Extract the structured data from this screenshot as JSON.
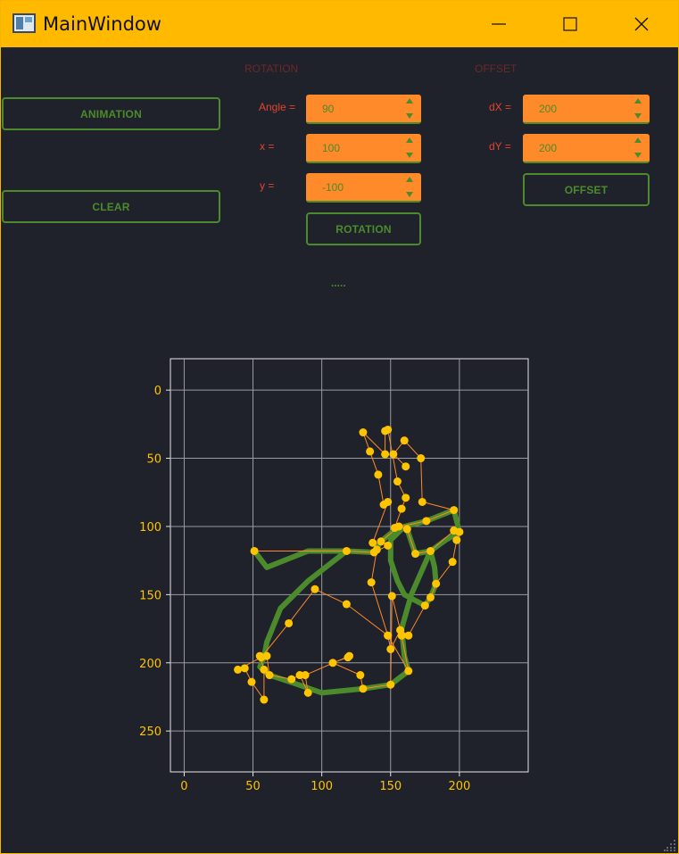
{
  "window": {
    "title": "MainWindow"
  },
  "left_panel": {
    "animation_label": "ANIMATION",
    "clear_label": "CLEAR"
  },
  "rotation": {
    "section_title": "ROTATION",
    "angle_label": "Angle =",
    "angle_value": "90",
    "x_label": "x =",
    "x_value": "100",
    "y_label": "y =",
    "y_value": "-100",
    "button_label": "ROTATION"
  },
  "offset": {
    "section_title": "OFFSET",
    "dx_label": "dX =",
    "dx_value": "200",
    "dy_label": "dY =",
    "dy_value": "200",
    "button_label": "OFFSET"
  },
  "status_text": ".....",
  "colors": {
    "titlebar": "#ffba00",
    "background": "#1f212b",
    "accent_green": "#4c8b2b",
    "label_red": "#e0452f",
    "spin_orange": "#ff8a2a",
    "point_yellow": "#ffc400",
    "control_line": "#ff8a2a",
    "curve_green": "#4c8b2b"
  },
  "chart_data": {
    "type": "line",
    "xlabel": "",
    "ylabel": "",
    "xlim": [
      -10,
      250
    ],
    "ylim": [
      280,
      -23
    ],
    "y_inverted": true,
    "grid": true,
    "x_ticks": [
      0,
      50,
      100,
      150,
      200
    ],
    "y_ticks": [
      0,
      50,
      100,
      150,
      200,
      250
    ],
    "control_points": [
      [
        51,
        118
      ],
      [
        118,
        118
      ],
      [
        138,
        119
      ],
      [
        148,
        114
      ],
      [
        143,
        111
      ],
      [
        156,
        100
      ],
      [
        162,
        102
      ],
      [
        168,
        120
      ],
      [
        179,
        118
      ],
      [
        196,
        103
      ],
      [
        200,
        104
      ],
      [
        198,
        110
      ],
      [
        195,
        126
      ],
      [
        183,
        142
      ],
      [
        179,
        152
      ],
      [
        175,
        158
      ],
      [
        163,
        180
      ],
      [
        157,
        176
      ],
      [
        150,
        190
      ],
      [
        148,
        180
      ],
      [
        163,
        206
      ],
      [
        158,
        180
      ],
      [
        151,
        151
      ],
      [
        150,
        216
      ],
      [
        130,
        219
      ],
      [
        128,
        209
      ],
      [
        108,
        200
      ],
      [
        119,
        196
      ],
      [
        120,
        195
      ],
      [
        88,
        209
      ],
      [
        90,
        222
      ],
      [
        84,
        209
      ],
      [
        78,
        212
      ],
      [
        62,
        209
      ],
      [
        60,
        195
      ],
      [
        55,
        195
      ],
      [
        58,
        205
      ],
      [
        58,
        227
      ],
      [
        49,
        214
      ],
      [
        44,
        204
      ],
      [
        39,
        205
      ],
      [
        56,
        196
      ],
      [
        76,
        171
      ],
      [
        95,
        146
      ],
      [
        118,
        157
      ],
      [
        148,
        180
      ],
      [
        136,
        141
      ],
      [
        140,
        117
      ],
      [
        137,
        112
      ],
      [
        148,
        82
      ],
      [
        145,
        84
      ],
      [
        141,
        62
      ],
      [
        135,
        45
      ],
      [
        130,
        31
      ],
      [
        146,
        47
      ],
      [
        146,
        30
      ],
      [
        148,
        29
      ],
      [
        155,
        67
      ],
      [
        161,
        79
      ],
      [
        158,
        87
      ],
      [
        153,
        101
      ],
      [
        176,
        96
      ],
      [
        196,
        88
      ],
      [
        173,
        82
      ],
      [
        172,
        50
      ],
      [
        160,
        37
      ],
      [
        152,
        47
      ],
      [
        161,
        56
      ]
    ],
    "curve": [
      [
        51,
        118
      ],
      [
        60,
        130
      ],
      [
        90,
        118
      ],
      [
        118,
        118
      ],
      [
        138,
        119
      ],
      [
        143,
        111
      ],
      [
        156,
        100
      ],
      [
        162,
        102
      ],
      [
        168,
        120
      ],
      [
        179,
        118
      ],
      [
        190,
        110
      ],
      [
        200,
        104
      ],
      [
        196,
        88
      ],
      [
        176,
        96
      ],
      [
        160,
        100
      ],
      [
        150,
        110
      ],
      [
        150,
        125
      ],
      [
        155,
        140
      ],
      [
        160,
        150
      ],
      [
        175,
        158
      ],
      [
        179,
        152
      ],
      [
        183,
        142
      ],
      [
        182,
        130
      ],
      [
        179,
        118
      ],
      [
        165,
        150
      ],
      [
        158,
        175
      ],
      [
        160,
        195
      ],
      [
        163,
        206
      ],
      [
        150,
        216
      ],
      [
        130,
        219
      ],
      [
        100,
        222
      ],
      [
        80,
        215
      ],
      [
        62,
        209
      ],
      [
        55,
        203
      ],
      [
        58,
        196
      ],
      [
        60,
        185
      ],
      [
        70,
        160
      ],
      [
        90,
        140
      ],
      [
        118,
        118
      ]
    ]
  }
}
